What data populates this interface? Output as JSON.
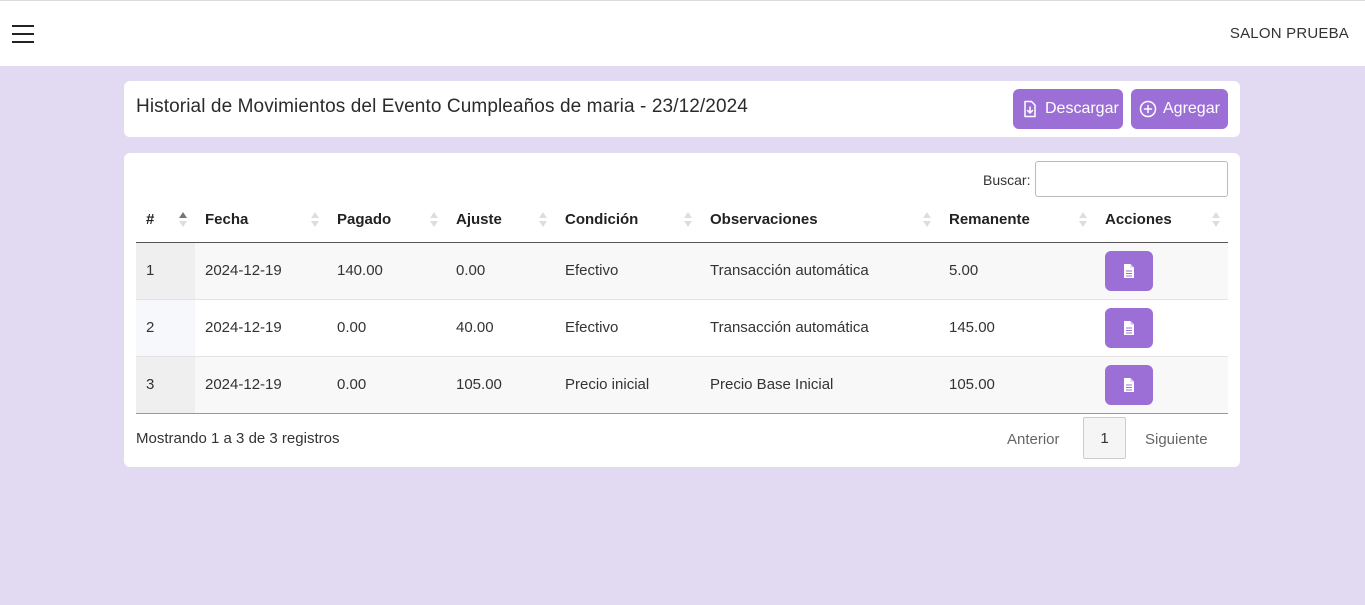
{
  "header": {
    "brand": "SALON PRUEBA",
    "menu_icon": "hamburger-menu-icon"
  },
  "title_card": {
    "title": "Historial de Movimientos del Evento Cumpleaños de maria - 23/12/2024",
    "download_label": "Descargar",
    "add_label": "Agregar"
  },
  "table": {
    "search_label": "Buscar:",
    "search_value": "",
    "columns": [
      "#",
      "Fecha",
      "Pagado",
      "Ajuste",
      "Condición",
      "Observaciones",
      "Remanente",
      "Acciones"
    ],
    "sorted_column": "#",
    "rows": [
      {
        "num": "1",
        "fecha": "2024-12-19",
        "pagado": "140.00",
        "ajuste": "0.00",
        "condicion": "Efectivo",
        "observaciones": "Transacción automática",
        "remanente": "5.00",
        "action_icon": "document-icon"
      },
      {
        "num": "2",
        "fecha": "2024-12-19",
        "pagado": "0.00",
        "ajuste": "40.00",
        "condicion": "Efectivo",
        "observaciones": "Transacción automática",
        "remanente": "145.00",
        "action_icon": "document-icon"
      },
      {
        "num": "3",
        "fecha": "2024-12-19",
        "pagado": "0.00",
        "ajuste": "105.00",
        "condicion": "Precio inicial",
        "observaciones": "Precio Base Inicial",
        "remanente": "105.00",
        "action_icon": "document-icon"
      }
    ],
    "info": "Mostrando 1 a 3 de 3 registros",
    "pagination": {
      "prev": "Anterior",
      "current_page": "1",
      "next": "Siguiente"
    }
  },
  "colors": {
    "background": "#e2d9f3",
    "accent": "#9c6fd6"
  }
}
